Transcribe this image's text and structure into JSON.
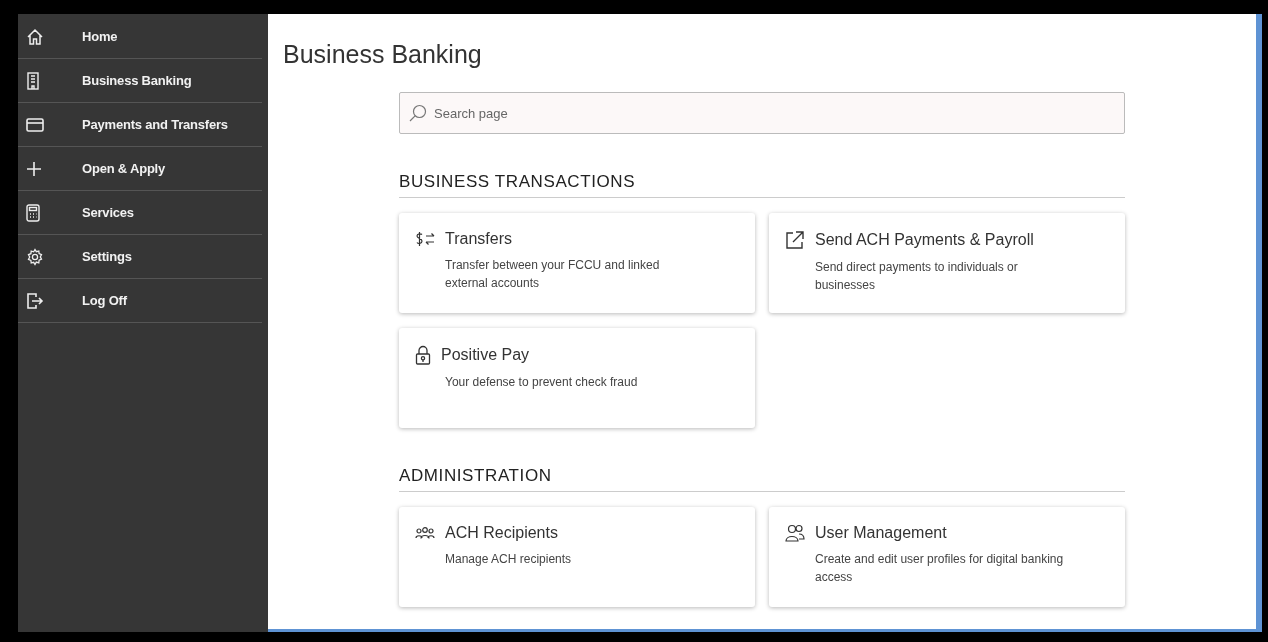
{
  "sidebar": {
    "items": [
      {
        "label": "Home",
        "kind": "home"
      },
      {
        "label": "Business Banking",
        "kind": "building"
      },
      {
        "label": "Payments and Transfers",
        "kind": "card"
      },
      {
        "label": "Open & Apply",
        "kind": "plus"
      },
      {
        "label": "Services",
        "kind": "calculator"
      },
      {
        "label": "Settings",
        "kind": "gear"
      },
      {
        "label": "Log Off",
        "kind": "logout"
      }
    ]
  },
  "page": {
    "title": "Business Banking"
  },
  "search": {
    "placeholder": "Search page"
  },
  "sections": [
    {
      "heading": "BUSINESS TRANSACTIONS",
      "cards": [
        {
          "kind": "transfer",
          "title": "Transfers",
          "description": "Transfer between your FCCU and linked external accounts"
        },
        {
          "kind": "external",
          "title": "Send ACH Payments & Payroll",
          "description": "Send direct payments to individuals or businesses"
        },
        {
          "kind": "lock",
          "title": "Positive Pay",
          "description": "Your defense to prevent check fraud"
        }
      ]
    },
    {
      "heading": "ADMINISTRATION",
      "cards": [
        {
          "kind": "group",
          "title": "ACH Recipients",
          "description": "Manage ACH recipients"
        },
        {
          "kind": "users",
          "title": "User Management",
          "description": "Create and edit user profiles for digital banking access"
        }
      ]
    }
  ]
}
